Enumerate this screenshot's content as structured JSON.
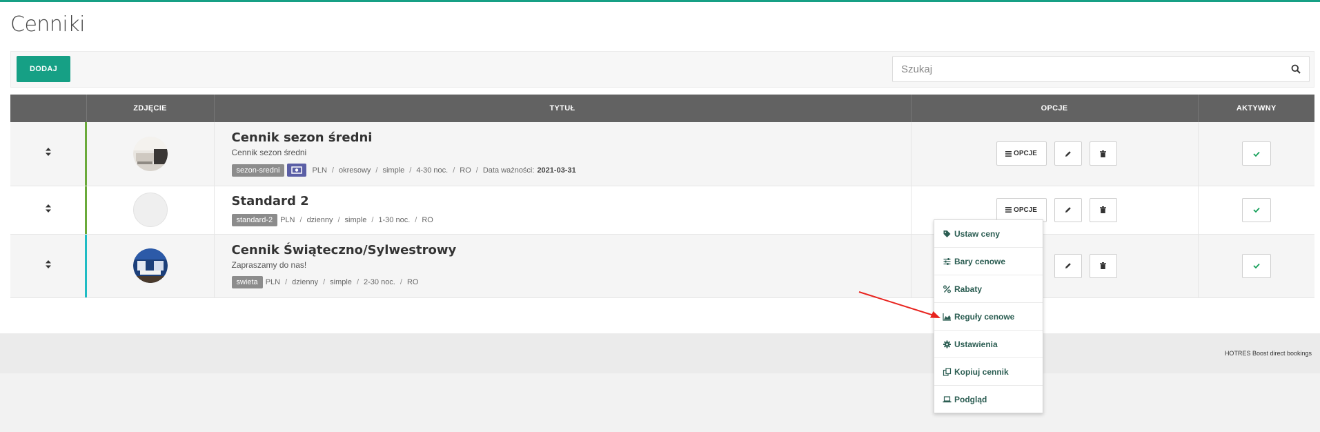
{
  "page": {
    "title": "Cenniki"
  },
  "toolbar": {
    "add_label": "DODAJ",
    "search_placeholder": "Szukaj"
  },
  "table": {
    "headers": [
      "",
      "ZDJĘCIE",
      "TYTUŁ",
      "OPCJE",
      "AKTYWNY"
    ],
    "options_label": "OPCJE",
    "rows": [
      {
        "name": "Cennik sezon średni",
        "subtitle": "Cennik sezon średni",
        "tag": "sezon-sredni",
        "currency": "PLN",
        "period": "okresowy",
        "type": "simple",
        "nights": "4-30 noc.",
        "board": "RO",
        "validity_label": "Data ważności:",
        "validity_date": "2021-03-31",
        "strip_color": "#6aaa3a"
      },
      {
        "name": "Standard 2",
        "tag": "standard-2",
        "currency": "PLN",
        "period": "dzienny",
        "type": "simple",
        "nights": "1-30 noc.",
        "board": "RO",
        "strip_color": "#6aaa3a"
      },
      {
        "name": "Cennik Świąteczno/Sylwestrowy",
        "subtitle": "Zapraszamy do nas!",
        "tag": "swieta",
        "currency": "PLN",
        "period": "dzienny",
        "type": "simple",
        "nights": "2-30 noc.",
        "board": "RO",
        "strip_color": "#1fbcc4"
      }
    ]
  },
  "dropdown": {
    "items": [
      {
        "label": "Ustaw ceny",
        "icon": "tag-icon"
      },
      {
        "label": "Bary cenowe",
        "icon": "sliders-icon"
      },
      {
        "label": "Rabaty",
        "icon": "percent-icon"
      },
      {
        "label": "Reguły cenowe",
        "icon": "area-chart-icon"
      },
      {
        "label": "Ustawienia",
        "icon": "gear-icon"
      },
      {
        "label": "Kopiuj cennik",
        "icon": "copy-icon"
      },
      {
        "label": "Podgląd",
        "icon": "laptop-icon"
      }
    ]
  },
  "footer": {
    "text": "HOTRES Boost direct bookings"
  },
  "colors": {
    "accent": "#16a085",
    "header_bg": "#626262",
    "link": "#2b5d52",
    "annotation_arrow": "#e8231e"
  }
}
